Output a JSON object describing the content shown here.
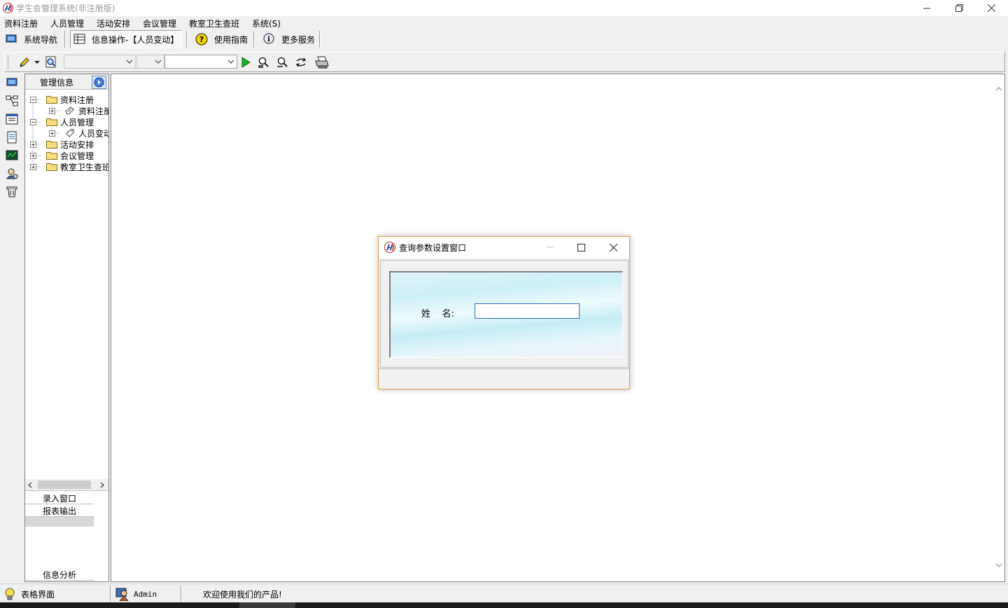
{
  "window": {
    "title": "学生会管理系统(非注册版)",
    "accent": "#e0a040"
  },
  "menu": [
    "资料注册",
    "人员管理",
    "活动安排",
    "会议管理",
    "教室卫生查班",
    "系统(S)"
  ],
  "navbar": {
    "system_nav": "系统导航",
    "info_op": "信息操作-【人员变动】",
    "guide": "使用指南",
    "more": "更多服务"
  },
  "panel": {
    "header": "管理信息",
    "tree": [
      {
        "label": "资料注册",
        "expanded": true
      },
      {
        "label": "资料注册",
        "child": true
      },
      {
        "label": "人员管理",
        "expanded": true
      },
      {
        "label": "人员变动",
        "child": true
      },
      {
        "label": "活动安排",
        "expanded": false
      },
      {
        "label": "会议管理",
        "expanded": false
      },
      {
        "label": "教室卫生查班",
        "expanded": false
      }
    ],
    "bottom_items": [
      "录入窗口",
      "报表输出",
      "信息分析"
    ]
  },
  "status": {
    "mode": "表格界面",
    "user": "Admin",
    "message": "欢迎使用我们的产品!"
  },
  "dialog": {
    "title": "查询参数设置窗口",
    "name_label": "姓    名:",
    "name_value": ""
  }
}
